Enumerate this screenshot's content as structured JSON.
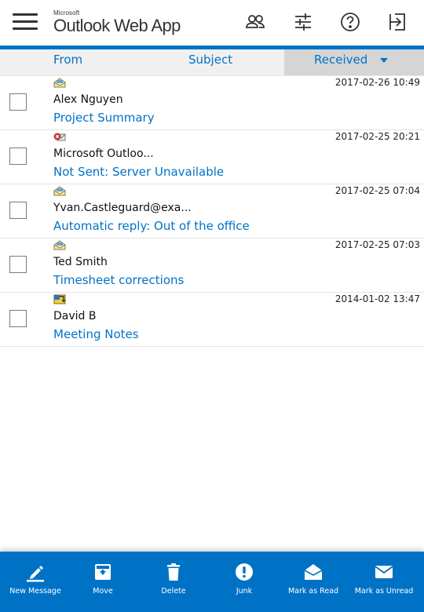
{
  "header": {
    "brand_company": "Microsoft",
    "brand_app": "Outlook Web App",
    "icons": [
      "menu-icon",
      "people-icon",
      "settings-sliders-icon",
      "help-icon",
      "sign-out-icon"
    ]
  },
  "columns": {
    "from": "From",
    "subject": "Subject",
    "received": "Received"
  },
  "messages": [
    {
      "icon": "envelope-read-icon",
      "date": "2017-02-26 10:49",
      "sender": "Alex Nguyen",
      "subject": "Project Summary"
    },
    {
      "icon": "envelope-error-icon",
      "date": "2017-02-25 20:21",
      "sender": "Microsoft Outloo...",
      "subject": "Not Sent: Server Unavailable"
    },
    {
      "icon": "envelope-read-icon",
      "date": "2017-02-25 07:04",
      "sender": "Yvan.Castleguard@exa...",
      "subject": "Automatic reply: Out of the office"
    },
    {
      "icon": "envelope-read-icon",
      "date": "2017-02-25 07:03",
      "sender": "Ted Smith",
      "subject": "Timesheet corrections"
    },
    {
      "icon": "meeting-request-icon",
      "date": "2014-01-02 13:47",
      "sender": "David B",
      "subject": "Meeting Notes"
    }
  ],
  "toolbar": {
    "new_message": "New Message",
    "move": "Move",
    "delete": "Delete",
    "junk": "Junk",
    "mark_read": "Mark as Read",
    "mark_unread": "Mark as Unread"
  },
  "colors": {
    "accent": "#0072c6",
    "sorted_column_bg": "#d5d5d5",
    "header_bg": "#f0f0f0"
  }
}
